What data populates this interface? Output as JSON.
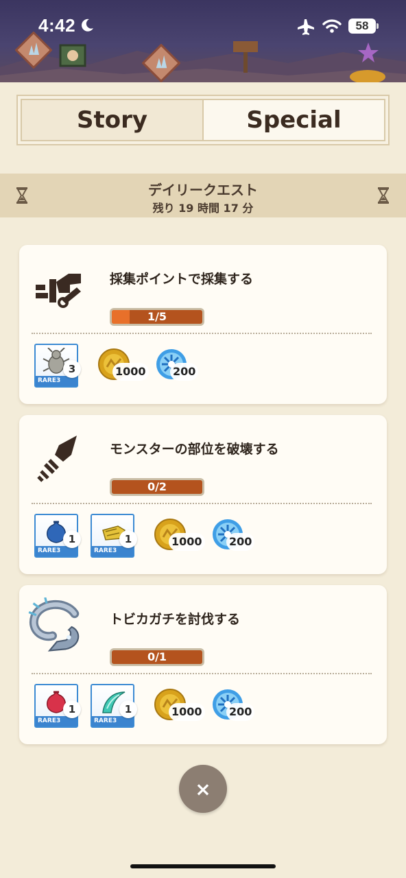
{
  "status_bar": {
    "time": "4:42",
    "battery": "58"
  },
  "tabs": [
    {
      "label": "Story",
      "selected": false
    },
    {
      "label": "Special",
      "selected": true
    }
  ],
  "daily_quest": {
    "title": "デイリークエスト",
    "remaining": "残り  19 時間 17 分"
  },
  "quests": [
    {
      "title": "採集ポイントで採集する",
      "icon": "gathering-icon",
      "progress_text": "1/5",
      "progress_fraction": 0.2,
      "items": [
        {
          "rarity": "RARE3",
          "count": "3",
          "icon": "beetle-icon",
          "color": "#9a9a92"
        }
      ],
      "zenny": "1000",
      "points": "200"
    },
    {
      "title": "モンスターの部位を破壊する",
      "icon": "broken-sword-icon",
      "progress_text": "0/2",
      "progress_fraction": 0,
      "items": [
        {
          "rarity": "RARE3",
          "count": "1",
          "icon": "blue-pouch-icon",
          "color": "#2f67b8"
        },
        {
          "rarity": "RARE3",
          "count": "1",
          "icon": "yellow-part-icon",
          "color": "#e5c33a"
        }
      ],
      "zenny": "1000",
      "points": "200"
    },
    {
      "title": "トビカガチを討伐する",
      "icon": "tobi-kadachi-icon",
      "progress_text": "0/1",
      "progress_fraction": 0,
      "items": [
        {
          "rarity": "RARE3",
          "count": "1",
          "icon": "red-pouch-icon",
          "color": "#d8324a"
        },
        {
          "rarity": "RARE3",
          "count": "1",
          "icon": "teal-claw-icon",
          "color": "#3fc8b4"
        }
      ],
      "zenny": "1000",
      "points": "200"
    }
  ],
  "close_label": "×",
  "colors": {
    "background": "#f3ecd9",
    "progress_track": "#b4531e",
    "progress_fill": "#e8702a",
    "rarity_blue": "#3b84cf"
  }
}
